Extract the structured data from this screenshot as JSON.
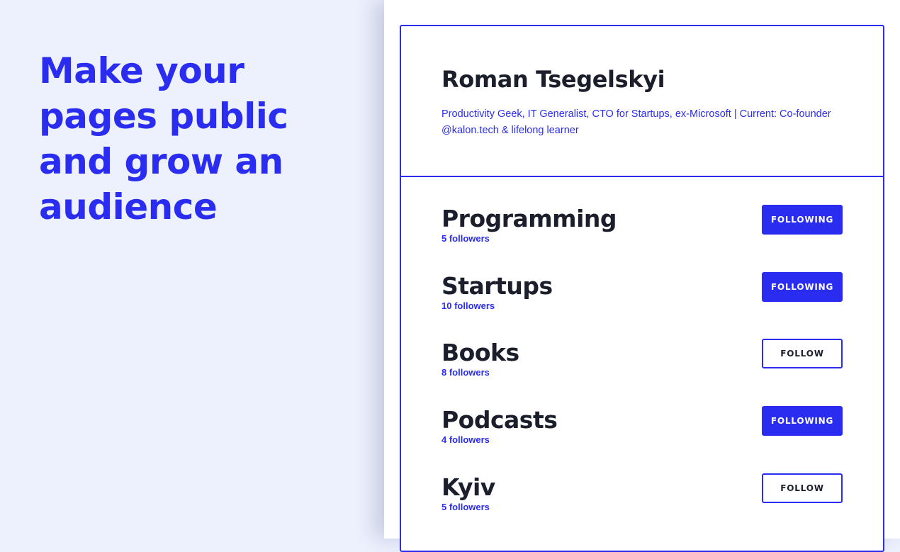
{
  "hero": {
    "headline": "Make your pages public and grow an audience"
  },
  "profile": {
    "name": "Roman Tsegelskyi",
    "bio": "Productivity Geek, IT Generalist, CTO for Startups, ex-Microsoft | Current: Co-founder @kalon.tech & lifelong learner"
  },
  "topics": [
    {
      "name": "Programming",
      "followers": "5 followers",
      "button_label": "FOLLOWING",
      "following": true
    },
    {
      "name": "Startups",
      "followers": "10 followers",
      "button_label": "FOLLOWING",
      "following": true
    },
    {
      "name": "Books",
      "followers": "8 followers",
      "button_label": "FOLLOW",
      "following": false
    },
    {
      "name": "Podcasts",
      "followers": "4 followers",
      "button_label": "FOLLOWING",
      "following": true
    },
    {
      "name": "Kyiv",
      "followers": "5 followers",
      "button_label": "FOLLOW",
      "following": false
    }
  ],
  "colors": {
    "accent": "#2a2df0",
    "text_dark": "#1b1e2b",
    "left_background": "#edf1fe",
    "card_background": "#ffffff"
  }
}
